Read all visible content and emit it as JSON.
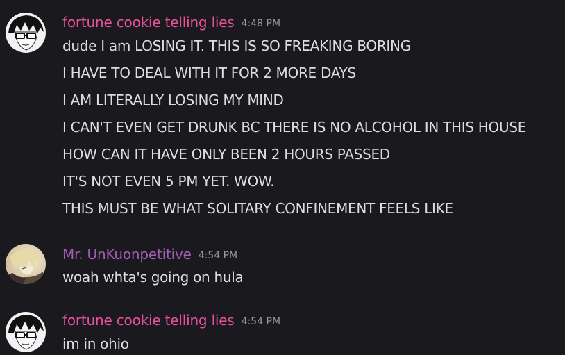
{
  "colors": {
    "background": "#1a1a1e",
    "text": "#dbdee1",
    "timestamp": "#949ba4",
    "user_fortune": "#e8509a",
    "user_mr": "#a45db5"
  },
  "messages": [
    {
      "author": "fortune cookie telling lies",
      "time": "4:48 PM",
      "avatar_icon": "manga-face-avatar-icon",
      "lines": [
        "dude I am LOSING IT. THIS IS SO FREAKING BORING",
        "I HAVE TO DEAL WITH IT FOR 2 MORE DAYS",
        "I AM LITERALLY LOSING MY MIND",
        "I CAN'T EVEN GET DRUNK BC THERE IS NO ALCOHOL IN THIS HOUSE",
        "HOW CAN IT HAVE ONLY BEEN 2 HOURS PASSED",
        "IT'S NOT EVEN 5 PM YET. WOW.",
        "THIS MUST BE WHAT SOLITARY CONFINEMENT FEELS LIKE"
      ]
    },
    {
      "author": "Mr. UnKuonpetitive",
      "time": "4:54 PM",
      "avatar_icon": "anime-character-avatar-icon",
      "lines": [
        "woah whta's going on hula"
      ]
    },
    {
      "author": "fortune cookie telling lies",
      "time": "4:54 PM",
      "avatar_icon": "manga-face-avatar-icon",
      "lines": [
        "im in ohio"
      ]
    }
  ]
}
